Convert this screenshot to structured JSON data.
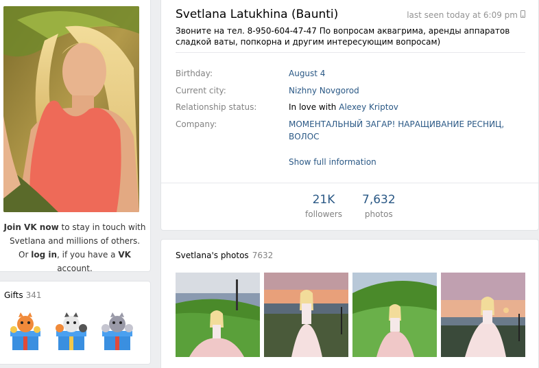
{
  "profile": {
    "name": "Svetlana Latukhina (Baunti)",
    "last_seen": "last seen today at 6:09 pm",
    "status": "Звоните на тел. 8-950-604-47-47 По вопросам аквагрима, аренды аппаратов сладкой ваты, попкорна и другим интересующим вопросам)",
    "info": {
      "birthday_label": "Birthday:",
      "birthday_value": "August 4",
      "city_label": "Current city:",
      "city_value": "Nizhny Novgorod",
      "relationship_label": "Relationship status:",
      "relationship_prefix": "In love with",
      "relationship_partner": "Alexey Kriptov",
      "company_label": "Company:",
      "company_value": "МОМЕНТАЛЬНЫЙ ЗАГАР! НАРАЩИВАНИЕ РЕСНИЦ, ВОЛОС"
    },
    "show_full_info": "Show full information",
    "counters": {
      "followers_num": "21K",
      "followers_label": "followers",
      "photos_num": "7,632",
      "photos_label": "photos"
    }
  },
  "join": {
    "join_link": "Join VK now",
    "join_text1": "to stay in touch with",
    "join_text2": "Svetlana and millions of others.",
    "or": "Or",
    "login_link": "log in",
    "if_text": ", if you have a",
    "vk": "VK",
    "account": "account."
  },
  "gifts": {
    "title": "Gifts",
    "count": "341"
  },
  "photos": {
    "title": "Svetlana's photos",
    "count": "7632"
  },
  "colors": {
    "link": "#2a5885",
    "muted": "#828282",
    "background": "#edeef0"
  }
}
